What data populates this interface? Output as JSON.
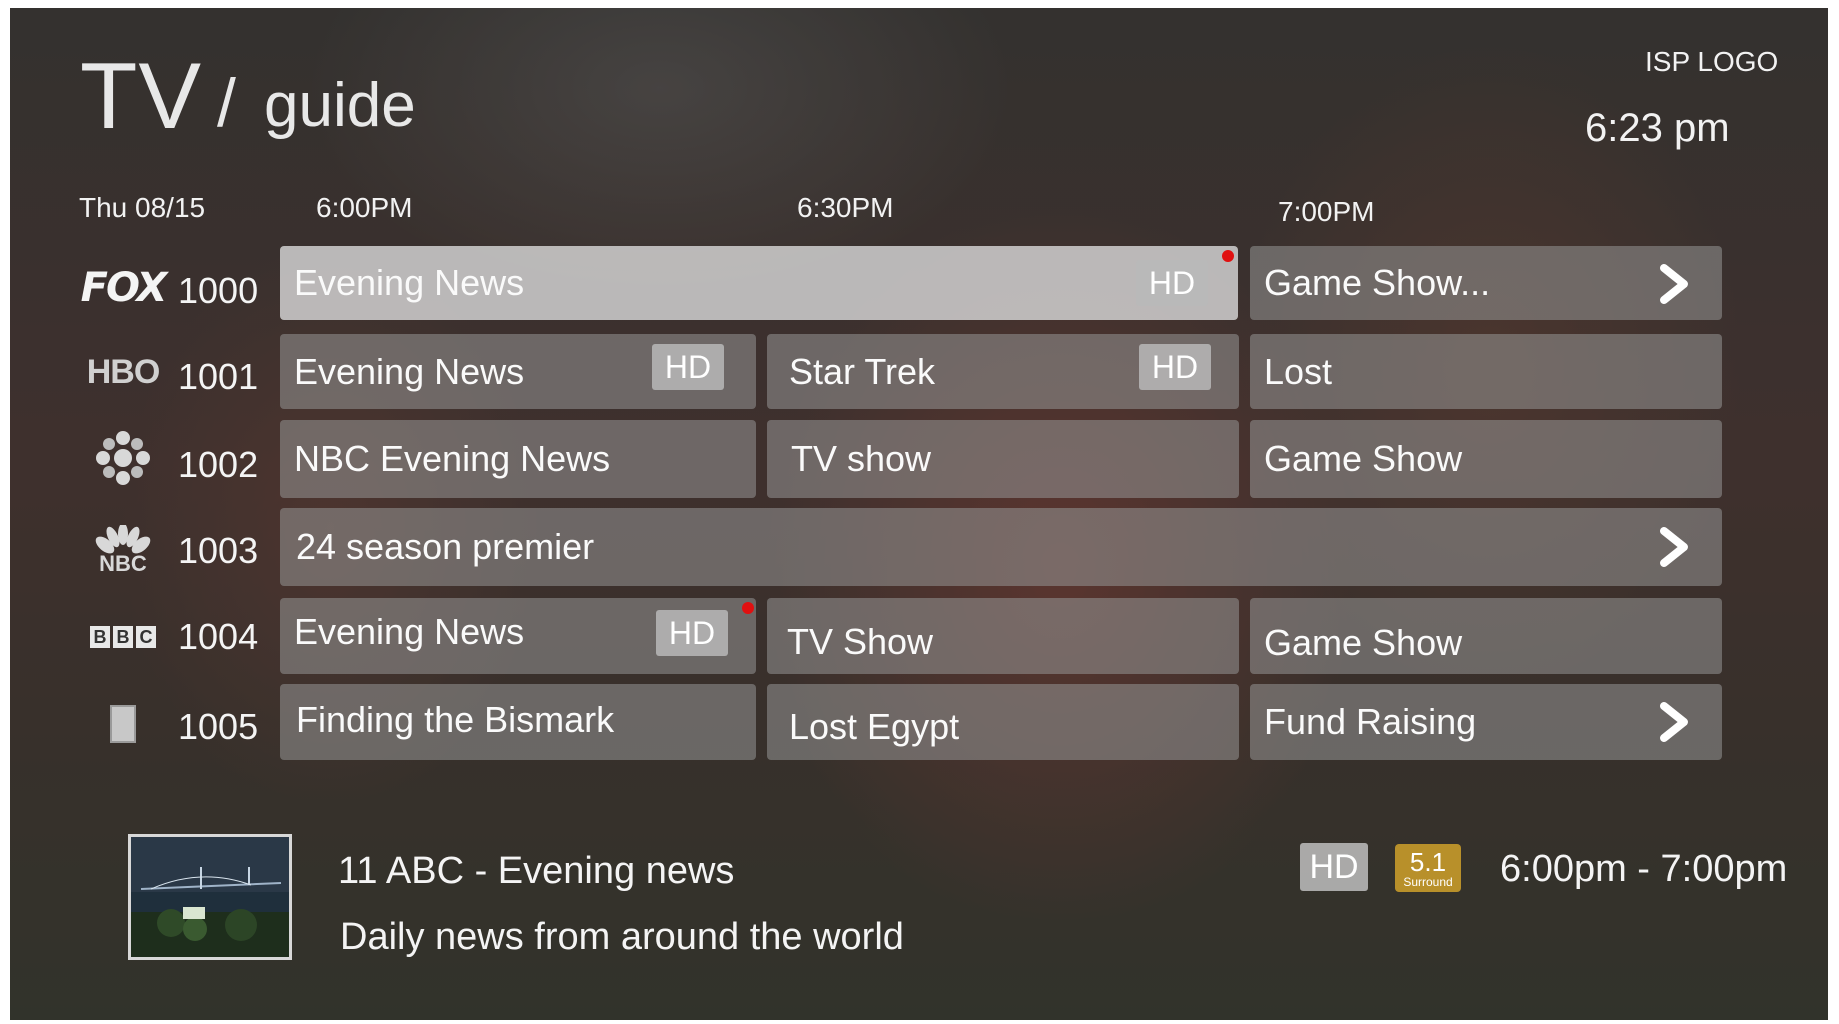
{
  "header": {
    "title_main": "TV",
    "title_slash": "/",
    "title_sub": "guide",
    "isp_logo": "ISP LOGO",
    "clock": "6:23 pm"
  },
  "timeline": {
    "date": "Thu 08/15",
    "slots": [
      "6:00PM",
      "6:30PM",
      "7:00PM"
    ]
  },
  "channels": [
    {
      "number": "1000",
      "logo": "fox-logo",
      "logo_text": "FOX",
      "programs": [
        {
          "title": "Evening News",
          "hd_label": "HD",
          "recording": true,
          "selected": true
        },
        {
          "title": "Game Show...",
          "more_arrow": true
        }
      ]
    },
    {
      "number": "1001",
      "logo": "hbo-logo",
      "logo_text": "HBO",
      "programs": [
        {
          "title": "Evening News",
          "hd_label": "HD"
        },
        {
          "title": "Star Trek",
          "hd_label": "HD"
        },
        {
          "title": "Lost"
        }
      ]
    },
    {
      "number": "1002",
      "logo": "cbc-gem-logo",
      "programs": [
        {
          "title": "NBC Evening News"
        },
        {
          "title": "TV show"
        },
        {
          "title": "Game Show"
        }
      ]
    },
    {
      "number": "1003",
      "logo": "nbc-peacock-logo",
      "logo_text": "NBC",
      "programs": [
        {
          "title": "24 season premier",
          "more_arrow": true
        }
      ]
    },
    {
      "number": "1004",
      "logo": "bbc-logo",
      "logo_text": [
        "B",
        "B",
        "C"
      ],
      "programs": [
        {
          "title": "Evening News",
          "hd_label": "HD",
          "recording": true
        },
        {
          "title": "TV Show"
        },
        {
          "title": "Game Show"
        }
      ]
    },
    {
      "number": "1005",
      "logo": "generic-channel-icon",
      "programs": [
        {
          "title": "Finding the Bismark"
        },
        {
          "title": "Lost Egypt"
        },
        {
          "title": "Fund Raising",
          "more_arrow": true
        }
      ]
    }
  ],
  "info": {
    "title": "11 ABC - Evening news",
    "description": "Daily news from around the world",
    "hd_label": "HD",
    "surround_value": "5.1",
    "surround_label": "Surround",
    "time_range": "6:00pm - 7:00pm"
  },
  "colors": {
    "recording_dot": "#e01010",
    "surround_badge": "#b8902a",
    "cell_bg": "#969696",
    "cell_selected_bg": "#d7d7d7"
  }
}
